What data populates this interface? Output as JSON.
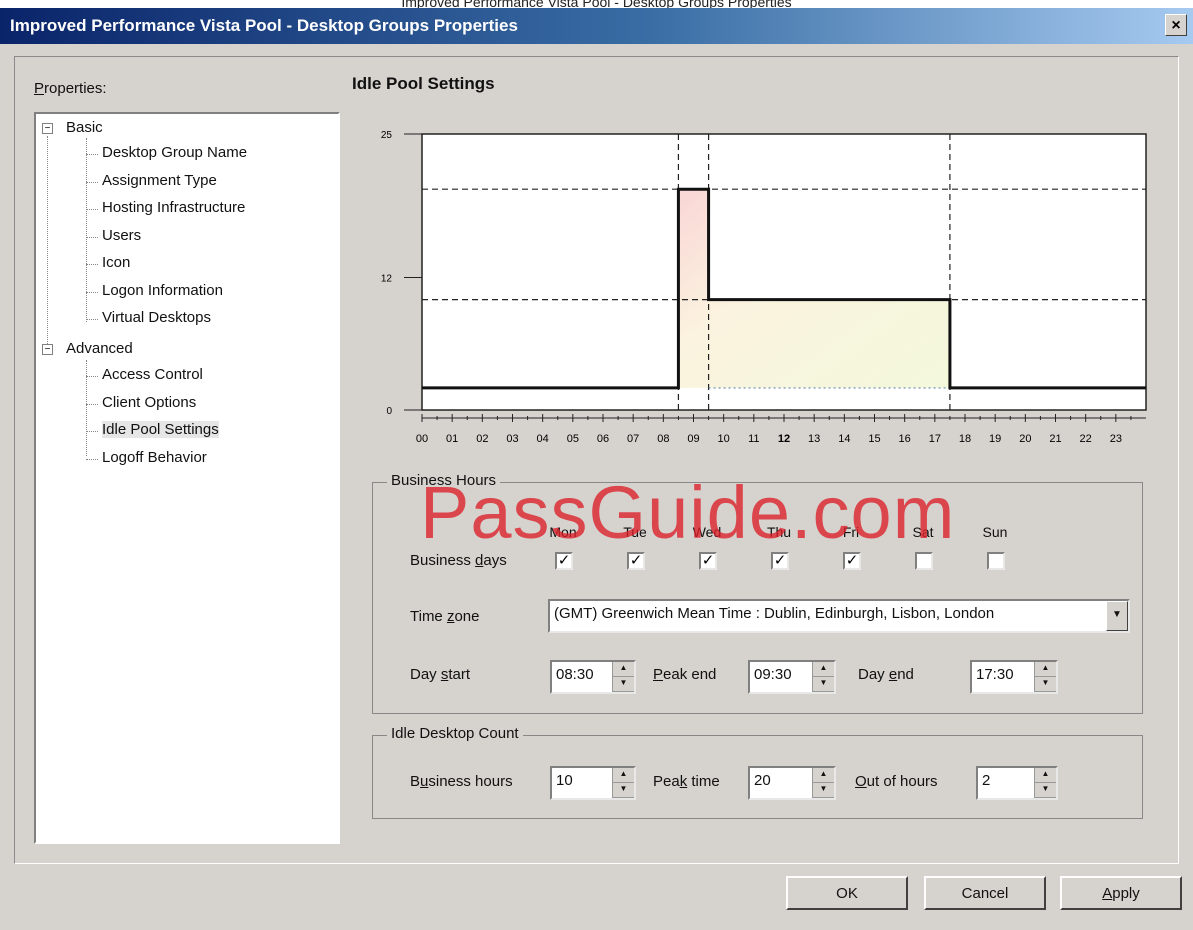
{
  "top_strip": "Improved Performance Vista Pool - Desktop Groups Properties",
  "window": {
    "title": "Improved Performance Vista Pool - Desktop Groups Properties",
    "close": "×"
  },
  "properties_label": "Properties:",
  "tree": {
    "basic": "Basic",
    "basic_items": [
      "Desktop Group Name",
      "Assignment Type",
      "Hosting Infrastructure",
      "Users",
      "Icon",
      "Logon Information",
      "Virtual Desktops"
    ],
    "advanced": "Advanced",
    "advanced_items": [
      "Access Control",
      "Client Options",
      "Idle Pool Settings",
      "Logoff Behavior"
    ],
    "selected": "Idle Pool Settings"
  },
  "section_title": "Idle Pool Settings",
  "chart_data": {
    "type": "line",
    "x_ticks": [
      "00",
      "01",
      "02",
      "03",
      "04",
      "05",
      "06",
      "07",
      "08",
      "09",
      "10",
      "11",
      "12",
      "13",
      "14",
      "15",
      "16",
      "17",
      "18",
      "19",
      "20",
      "21",
      "22",
      "23"
    ],
    "y_ticks": [
      "0",
      "12",
      "25"
    ],
    "ylim": [
      0,
      25
    ],
    "xlim": [
      0,
      24
    ],
    "series": [
      {
        "x": [
          0,
          8.5,
          8.5,
          9.5,
          9.5,
          17.5,
          17.5,
          24
        ],
        "y": [
          2,
          2,
          20,
          20,
          10,
          10,
          2,
          2
        ]
      }
    ],
    "grid": "dashed reference lines at y=20 and y=10 and x=8.5, 9.5, 17.5"
  },
  "business_hours": {
    "title": "Business Hours",
    "days_label": "Business days",
    "days": [
      {
        "name": "Mon",
        "checked": true
      },
      {
        "name": "Tue",
        "checked": true
      },
      {
        "name": "Wed",
        "checked": true
      },
      {
        "name": "Thu",
        "checked": true
      },
      {
        "name": "Fri",
        "checked": true
      },
      {
        "name": "Sat",
        "checked": false
      },
      {
        "name": "Sun",
        "checked": false
      }
    ],
    "check_mark": "✓",
    "timezone_label": "Time zone",
    "timezone_value": "(GMT) Greenwich Mean Time : Dublin, Edinburgh, Lisbon, London",
    "day_start_label": "Day start",
    "day_start_value": "08:30",
    "peak_end_label": "Peak end",
    "peak_end_value": "09:30",
    "day_end_label": "Day end",
    "day_end_value": "17:30"
  },
  "idle_count": {
    "title": "Idle Desktop Count",
    "business_label": "Business hours",
    "business_value": "10",
    "peak_label": "Peak time",
    "peak_value": "20",
    "out_label": "Out of hours",
    "out_value": "2"
  },
  "buttons": {
    "ok": "OK",
    "cancel": "Cancel",
    "apply": "Apply"
  },
  "watermark": "PassGuide.com",
  "colors": {
    "title_start": "#0a246a",
    "title_end": "#a6caf0",
    "dialog_bg": "#d6d3ce",
    "watermark": "#dc1e28"
  }
}
